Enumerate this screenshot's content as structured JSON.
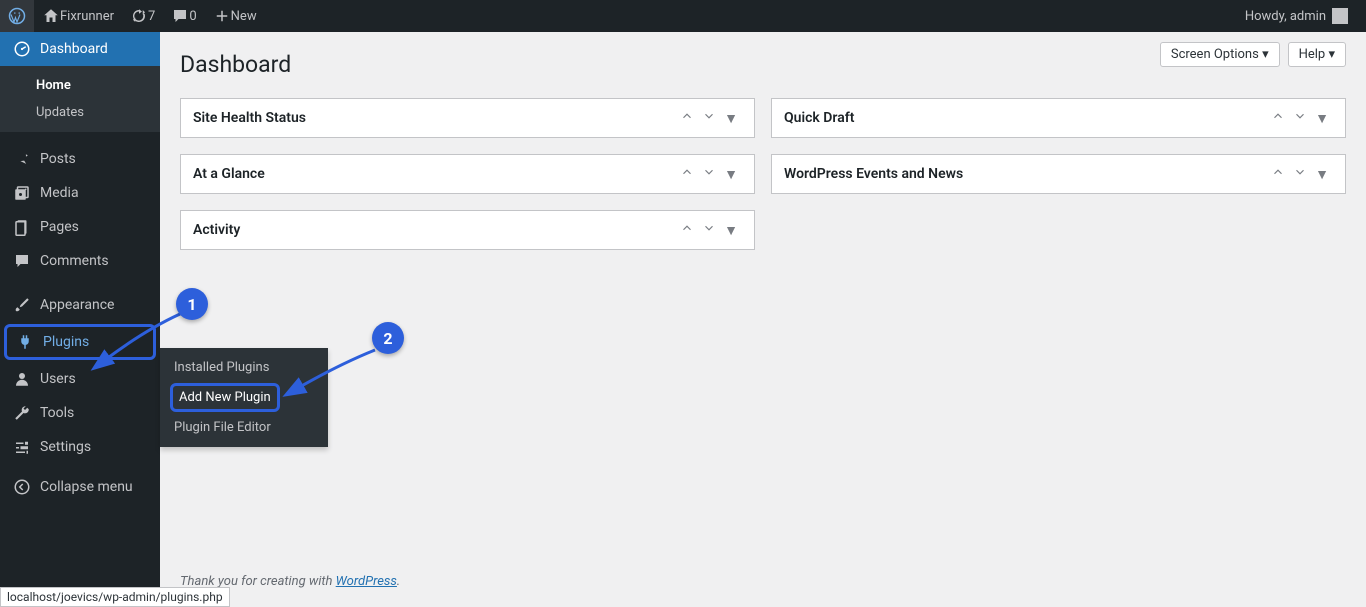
{
  "topbar": {
    "site_name": "Fixrunner",
    "updates_count": "7",
    "comments_count": "0",
    "new_label": "New",
    "howdy": "Howdy, admin"
  },
  "sidebar": {
    "dashboard": "Dashboard",
    "home": "Home",
    "updates": "Updates",
    "posts": "Posts",
    "media": "Media",
    "pages": "Pages",
    "comments": "Comments",
    "appearance": "Appearance",
    "plugins": "Plugins",
    "users": "Users",
    "tools": "Tools",
    "settings": "Settings",
    "collapse": "Collapse menu"
  },
  "flyout": {
    "installed": "Installed Plugins",
    "add_new": "Add New Plugin",
    "editor": "Plugin File Editor"
  },
  "main": {
    "title": "Dashboard",
    "screen_options": "Screen Options",
    "help": "Help",
    "panels_left": [
      "Site Health Status",
      "At a Glance",
      "Activity"
    ],
    "panels_right": [
      "Quick Draft",
      "WordPress Events and News"
    ],
    "footer_prefix": "Thank you for creating with ",
    "footer_link": "WordPress",
    "footer_suffix": "."
  },
  "annotations": {
    "one": "1",
    "two": "2"
  },
  "statusbar": {
    "url": "localhost/joevics/wp-admin/plugins.php"
  }
}
